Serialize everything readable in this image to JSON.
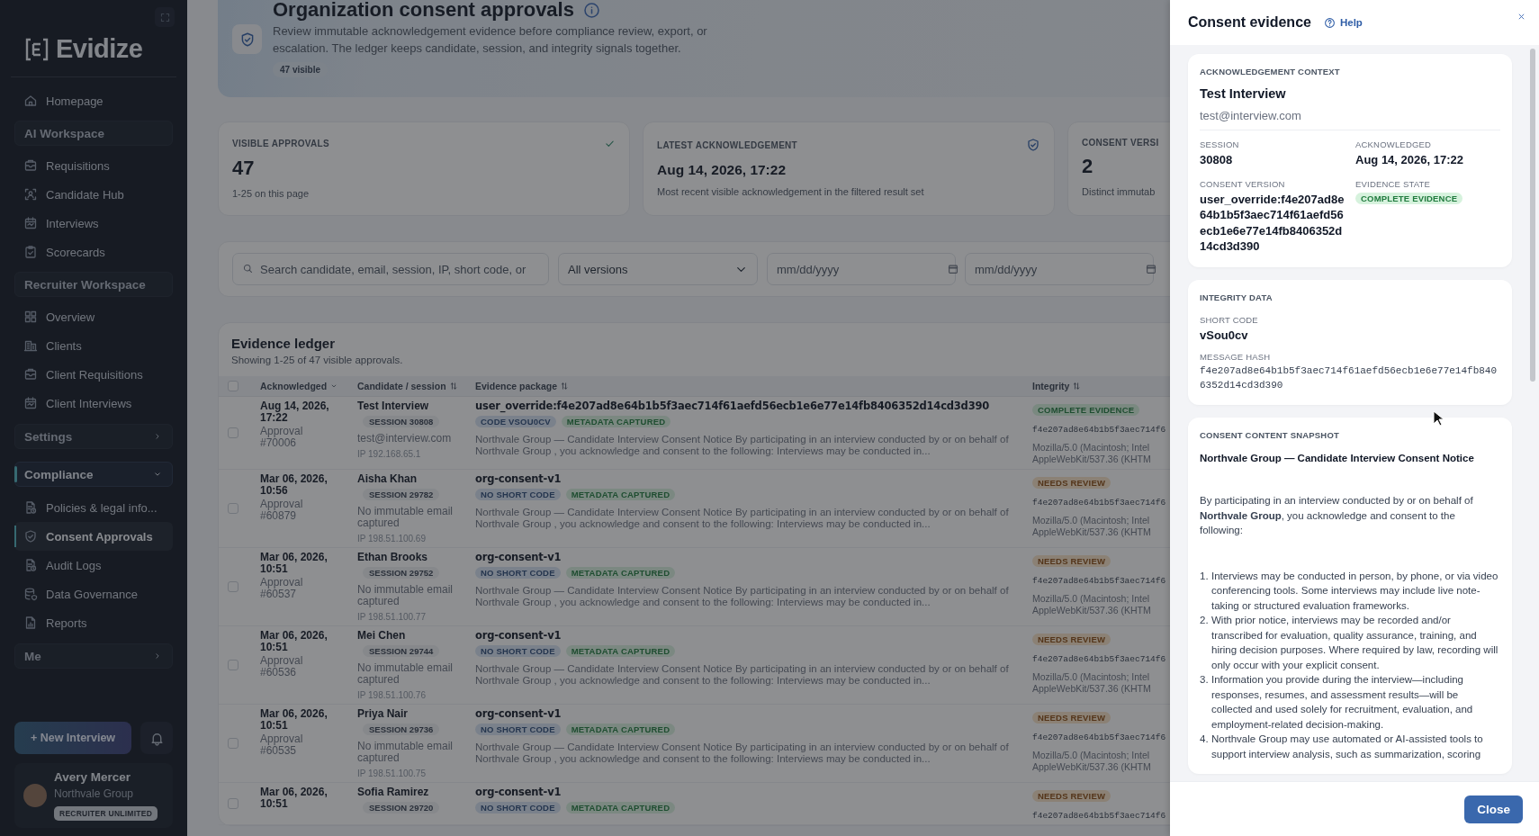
{
  "sidebar": {
    "logo": "Evidize",
    "nav": [
      {
        "kind": "link",
        "label": "Homepage",
        "selected": false
      },
      {
        "kind": "header",
        "label": "AI Workspace"
      },
      {
        "kind": "link",
        "label": "Requisitions",
        "selected": false
      },
      {
        "kind": "link",
        "label": "Candidate Hub",
        "selected": false
      },
      {
        "kind": "link",
        "label": "Interviews",
        "selected": false
      },
      {
        "kind": "link",
        "label": "Scorecards",
        "selected": false
      },
      {
        "kind": "header",
        "label": "Recruiter Workspace"
      },
      {
        "kind": "link",
        "label": "Overview",
        "selected": false
      },
      {
        "kind": "link",
        "label": "Clients",
        "selected": false
      },
      {
        "kind": "link",
        "label": "Client Requisitions",
        "selected": false
      },
      {
        "kind": "link",
        "label": "Client Interviews",
        "selected": false
      },
      {
        "kind": "collapsible",
        "label": "Settings",
        "expanded": false
      },
      {
        "kind": "collapsible",
        "label": "Compliance",
        "expanded": true,
        "children": [
          {
            "label": "Policies & legal info...",
            "selected": false
          },
          {
            "label": "Consent Approvals",
            "selected": true
          },
          {
            "label": "Audit Logs",
            "selected": false
          },
          {
            "label": "Data Governance",
            "selected": false
          },
          {
            "label": "Reports",
            "selected": false
          }
        ]
      },
      {
        "kind": "collapsible",
        "label": "Me",
        "expanded": false
      }
    ],
    "new_button": "+ New Interview",
    "user": {
      "name": "Avery Mercer",
      "org": "Northvale Group",
      "plan": "RECRUITER UNLIMITED"
    }
  },
  "header": {
    "title": "Organization consent approvals",
    "description": "Review immutable acknowledgement evidence before compliance review, export, or escalation. The ledger keeps candidate, session, and integrity signals together.",
    "count": "47 visible"
  },
  "stats": [
    {
      "label": "VISIBLE APPROVALS",
      "value": "47",
      "caption": "1-25 on this page"
    },
    {
      "label": "LATEST ACKNOWLEDGEMENT",
      "value": "Aug 14, 2026, 17:22",
      "caption": "Most recent visible acknowledgement in the filtered result set"
    },
    {
      "label": "CONSENT VERSI",
      "value": "2",
      "caption": "Distinct immutab"
    }
  ],
  "filters": {
    "search": {
      "placeholder": "Search candidate, email, session, IP, short code, or"
    },
    "version": {
      "value": "All versions"
    },
    "date_from": {
      "placeholder": "mm/dd/yyyy"
    },
    "date_to": {
      "placeholder": "mm/dd/yyyy"
    }
  },
  "ledger": {
    "title": "Evidence ledger",
    "subtitle": "Showing 1-25 of 47 visible approvals.",
    "all_checked": false,
    "columns": [
      {
        "label": "Acknowledged",
        "sorted": true
      },
      {
        "label": "Candidate / session",
        "sorted": false
      },
      {
        "label": "Evidence package",
        "sorted": false
      },
      {
        "label": "Integrity",
        "sorted": false
      }
    ],
    "rows": [
      {
        "checked": false,
        "acknowledged": "Aug 14, 2026, 17:22",
        "approval": "Approval #70006",
        "candidate": "Test Interview",
        "session": "SESSION 30808",
        "email": "test@interview.com",
        "ip": "IP 192.168.65.1",
        "package": "user_override:f4e207ad8e64b1b5f3aec714f61aefd56ecb1e6e77e14fb8406352d14cd3d390",
        "badges": [
          {
            "kind": "code",
            "label": "CODE VSOU0CV"
          },
          {
            "kind": "metadata",
            "label": "METADATA CAPTURED"
          }
        ],
        "excerpt": "Northvale Group — Candidate Interview Consent Notice By participating in an interview conducted by or on behalf of Northvale Group , you acknowledge and consent to the following: Interviews may be conducted in...",
        "status": {
          "kind": "complete",
          "label": "COMPLETE EVIDENCE"
        },
        "hash": "f4e207ad8e64b1b5f3aec714f6",
        "user_agent": "Mozilla/5.0 (Macintosh; Intel\nAppleWebKit/537.36 (KHTM"
      },
      {
        "checked": false,
        "acknowledged": "Mar 06, 2026, 10:56",
        "approval": "Approval #60879",
        "candidate": "Aisha Khan",
        "session": "SESSION 29782",
        "email": "No immutable email captured",
        "ip": "IP 198.51.100.69",
        "package": "org-consent-v1",
        "badges": [
          {
            "kind": "code",
            "label": "NO SHORT CODE"
          },
          {
            "kind": "metadata",
            "label": "METADATA CAPTURED"
          }
        ],
        "excerpt": "Northvale Group — Candidate Interview Consent Notice By participating in an interview conducted by or on behalf of Northvale Group , you acknowledge and consent to the following: Interviews may be conducted in...",
        "status": {
          "kind": "review",
          "label": "NEEDS REVIEW"
        },
        "hash": "f4e207ad8e64b1b5f3aec714f6",
        "user_agent": "Mozilla/5.0 (Macintosh; Intel\nAppleWebKit/537.36 (KHTM"
      },
      {
        "checked": false,
        "acknowledged": "Mar 06, 2026, 10:51",
        "approval": "Approval #60537",
        "candidate": "Ethan Brooks",
        "session": "SESSION 29752",
        "email": "No immutable email captured",
        "ip": "IP 198.51.100.77",
        "package": "org-consent-v1",
        "badges": [
          {
            "kind": "code",
            "label": "NO SHORT CODE"
          },
          {
            "kind": "metadata",
            "label": "METADATA CAPTURED"
          }
        ],
        "excerpt": "Northvale Group — Candidate Interview Consent Notice By participating in an interview conducted by or on behalf of Northvale Group , you acknowledge and consent to the following: Interviews may be conducted in...",
        "status": {
          "kind": "review",
          "label": "NEEDS REVIEW"
        },
        "hash": "f4e207ad8e64b1b5f3aec714f6",
        "user_agent": "Mozilla/5.0 (Macintosh; Intel\nAppleWebKit/537.36 (KHTM"
      },
      {
        "checked": false,
        "acknowledged": "Mar 06, 2026, 10:51",
        "approval": "Approval #60536",
        "candidate": "Mei Chen",
        "session": "SESSION 29744",
        "email": "No immutable email captured",
        "ip": "IP 198.51.100.76",
        "package": "org-consent-v1",
        "badges": [
          {
            "kind": "code",
            "label": "NO SHORT CODE"
          },
          {
            "kind": "metadata",
            "label": "METADATA CAPTURED"
          }
        ],
        "excerpt": "Northvale Group — Candidate Interview Consent Notice By participating in an interview conducted by or on behalf of Northvale Group , you acknowledge and consent to the following: Interviews may be conducted in...",
        "status": {
          "kind": "review",
          "label": "NEEDS REVIEW"
        },
        "hash": "f4e207ad8e64b1b5f3aec714f6",
        "user_agent": "Mozilla/5.0 (Macintosh; Intel\nAppleWebKit/537.36 (KHTM"
      },
      {
        "checked": false,
        "acknowledged": "Mar 06, 2026, 10:51",
        "approval": "Approval #60535",
        "candidate": "Priya Nair",
        "session": "SESSION 29736",
        "email": "No immutable email captured",
        "ip": "IP 198.51.100.75",
        "package": "org-consent-v1",
        "badges": [
          {
            "kind": "code",
            "label": "NO SHORT CODE"
          },
          {
            "kind": "metadata",
            "label": "METADATA CAPTURED"
          }
        ],
        "excerpt": "Northvale Group — Candidate Interview Consent Notice By participating in an interview conducted by or on behalf of Northvale Group , you acknowledge and consent to the following: Interviews may be conducted in...",
        "status": {
          "kind": "review",
          "label": "NEEDS REVIEW"
        },
        "hash": "f4e207ad8e64b1b5f3aec714f6",
        "user_agent": "Mozilla/5.0 (Macintosh; Intel\nAppleWebKit/537.36 (KHTM"
      },
      {
        "checked": false,
        "acknowledged": "Mar 06, 2026, 10:51",
        "candidate": "Sofia Ramirez",
        "session": "SESSION 29720",
        "package": "org-consent-v1",
        "badges": [
          {
            "kind": "code",
            "label": "NO SHORT CODE"
          },
          {
            "kind": "metadata",
            "label": "METADATA CAPTURED"
          }
        ],
        "status": {
          "kind": "review",
          "label": "NEEDS REVIEW"
        },
        "hash": "f4e207ad8e64b1b5f3aec714f6"
      }
    ]
  },
  "drawer": {
    "title": "Consent evidence",
    "help": "Help",
    "context": {
      "heading": "ACKNOWLEDGEMENT CONTEXT",
      "name": "Test Interview",
      "email": "test@interview.com",
      "fields": [
        {
          "label": "SESSION",
          "value": "30808"
        },
        {
          "label": "ACKNOWLEDGED",
          "value": "Aug 14, 2026, 17:22"
        },
        {
          "label": "CONSENT VERSION",
          "value": "user_override:f4e207ad8e64b1b5f3aec714f61aefd56ecb1e6e77e14fb8406352d14cd3d390"
        },
        {
          "label": "EVIDENCE STATE",
          "badge": {
            "kind": "complete",
            "label": "COMPLETE EVIDENCE"
          }
        }
      ]
    },
    "integrity": {
      "heading": "INTEGRITY DATA",
      "short_code_label": "SHORT CODE",
      "short_code": "vSou0cv",
      "hash_label": "MESSAGE HASH",
      "hash": "f4e207ad8e64b1b5f3aec714f61aefd56ecb1e6e77e14fb8406352d14cd3d390"
    },
    "snapshot": {
      "heading": "CONSENT CONTENT SNAPSHOT",
      "title": "Northvale Group — Candidate Interview Consent Notice",
      "intro": "By participating in an interview conducted by or on behalf of **Northvale Group**, you acknowledge and consent to the following:",
      "items": [
        {
          "number": "1.",
          "text": "Interviews may be conducted in person, by phone, or via video conferencing tools. Some interviews may include live note-taking or structured evaluation frameworks."
        },
        {
          "number": "2.",
          "text": "With prior notice, interviews may be recorded and/or transcribed for evaluation, quality assurance, training, and hiring decision purposes. Where required by law, recording will only occur with your explicit consent."
        },
        {
          "number": "3.",
          "text": "Information you provide during the interview—including responses, resumes, and assessment results—will be collected and used solely for recruitment, evaluation, and employment-related decision-making."
        },
        {
          "number": "4.",
          "text": "Northvale Group may use automated or AI-assisted tools to support interview analysis, such as summarization, scoring"
        }
      ]
    },
    "close": "Close"
  }
}
